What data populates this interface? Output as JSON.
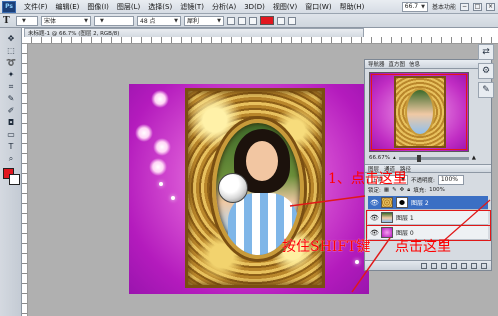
{
  "app": {
    "logo": "Ps",
    "menus": [
      "文件(F)",
      "编辑(E)",
      "图像(I)",
      "图层(L)",
      "选择(S)",
      "滤镜(T)",
      "分析(A)",
      "3D(D)",
      "视图(V)",
      "窗口(W)",
      "帮助(H)"
    ],
    "zoom_preset": "66.7",
    "workspace": "基本功能",
    "window_buttons": [
      "−",
      "□",
      "×"
    ]
  },
  "options_bar": {
    "tool_glyph": "T",
    "font_family": "宋体",
    "font_size": "48 点",
    "anti_alias": "犀利",
    "text_color": "#e2171f"
  },
  "document": {
    "tab_title": "未标题-1 @ 66.7% (图层 2, RGB/8)"
  },
  "toolbox": {
    "foreground_color": "#e2171f",
    "background_color": "#ffffff"
  },
  "navigator": {
    "tabs": [
      "导航器",
      "直方图",
      "信息"
    ],
    "zoom": "66.67%"
  },
  "layers_panel": {
    "tabs": [
      "图层",
      "通道",
      "路径"
    ],
    "blend_mode": "正常",
    "opacity_label": "不透明度:",
    "opacity": "100%",
    "lock_label": "锁定:",
    "fill_label": "填充:",
    "fill": "100%",
    "layers": [
      {
        "name": "图层 2",
        "active": true
      },
      {
        "name": "图层 1",
        "active": false
      },
      {
        "name": "图层 0",
        "active": false
      }
    ]
  },
  "annotations": {
    "step1": "1、点击这里",
    "shift_hint": "按住SHIFT键",
    "click_here": "点击这里"
  }
}
